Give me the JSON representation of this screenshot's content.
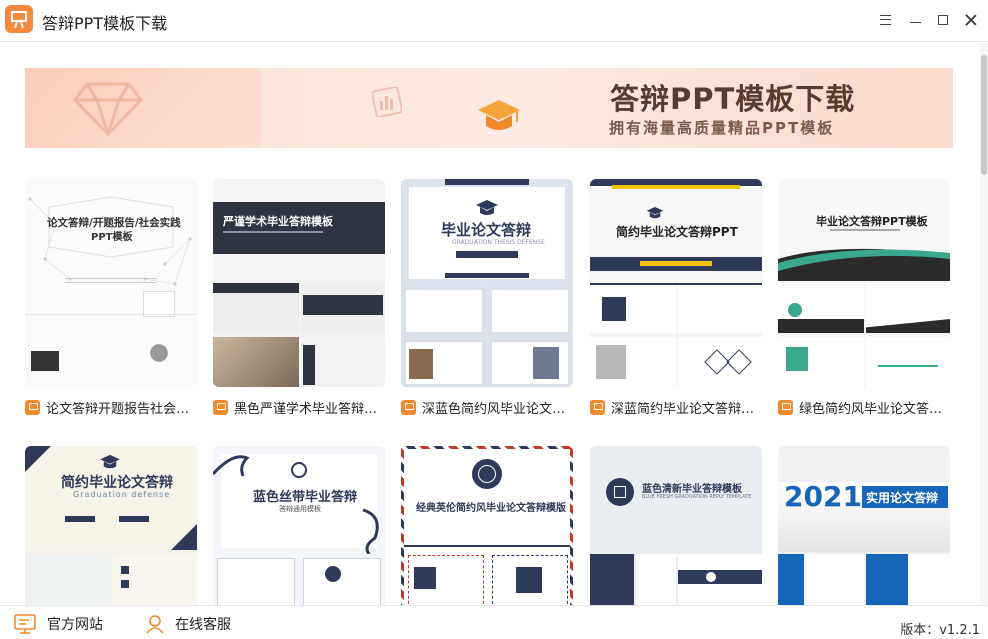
{
  "app": {
    "title": "答辩PPT模板下载"
  },
  "banner": {
    "title": "答辩PPT模板下载",
    "subtitle": "拥有海量高质量精品PPT模板"
  },
  "templates": [
    {
      "caption": "论文答辩开题报告社会实践PPT模板",
      "slide_title": "论文答辩/开题报告/社会实践",
      "slide_title2": "PPT模板"
    },
    {
      "caption": "黑色严谨学术毕业答辩PPT模板",
      "slide_title": "严谨学术毕业答辩模板"
    },
    {
      "caption": "深蓝色简约风毕业论文答辩PPT模板",
      "slide_title": "毕业论文答辩",
      "slide_sub": "GRADUATION THESIS DEFENSE"
    },
    {
      "caption": "深蓝简约毕业论文答辩PPT模板",
      "slide_title": "简约毕业论文答辩PPT"
    },
    {
      "caption": "绿色简约风毕业论文答辩PPT模板",
      "slide_title": "毕业论文答辩PPT模板"
    },
    {
      "slide_title": "简约毕业论文答辩",
      "slide_sub": "Graduation defense"
    },
    {
      "slide_title": "蓝色丝带毕业答辩",
      "slide_sub": "答辩通用模板"
    },
    {
      "slide_title": "经典英伦简约风毕业论文答辩模版"
    },
    {
      "slide_title": "蓝色清新毕业答辩模板",
      "slide_sub": "BLUE FRESH GRADUATION REPLY TEMPLATE"
    },
    {
      "slide_title": "2021",
      "slide_title2": "实用论文答辩"
    }
  ],
  "footer": {
    "site_label": "官方网站",
    "service_label": "在线客服",
    "version": "版本：v1.2.1"
  },
  "colors": {
    "accent": "#f08a2c",
    "navy": "#2f3a5a",
    "green": "#3aa88f",
    "blue": "#1565b8"
  }
}
